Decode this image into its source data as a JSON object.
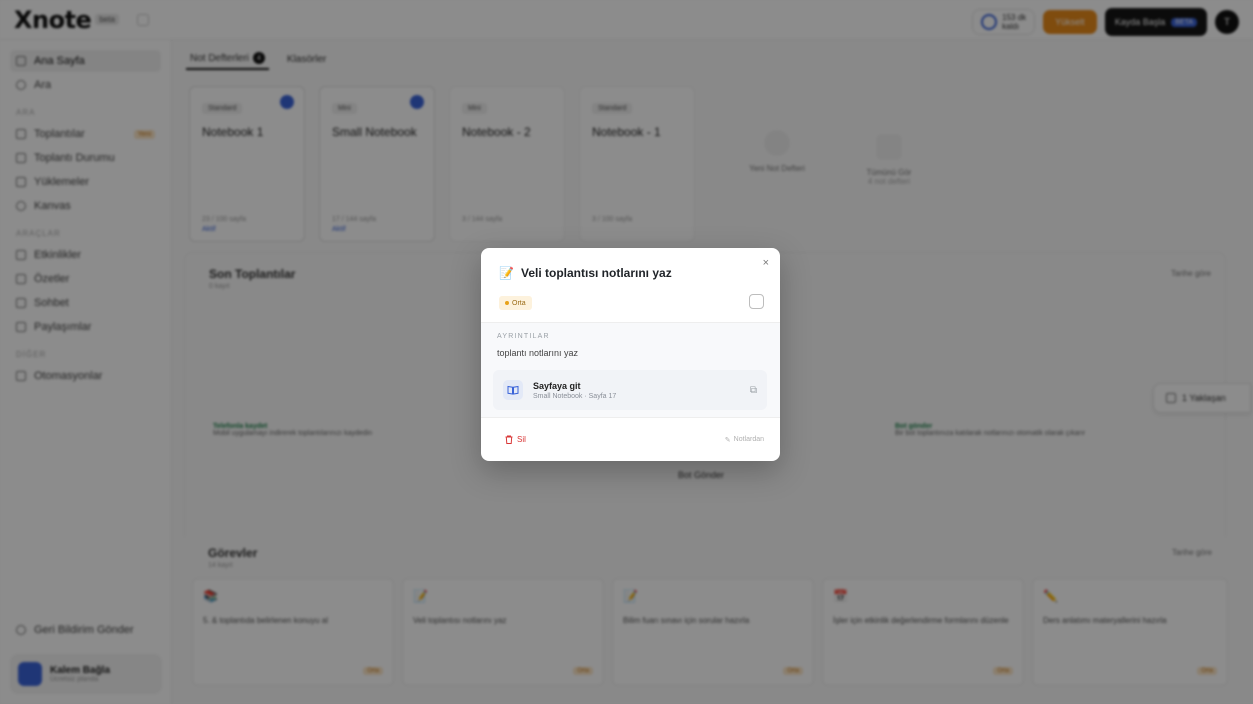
{
  "topbar": {
    "logo": "Xnote",
    "logo_badge": "beta",
    "credit_line1": "153 dk",
    "credit_line2": "kaldı",
    "upgrade_label": "Yükselt",
    "start_label": "Kayda Başla",
    "start_badge": "BETA",
    "avatar_initial": "T"
  },
  "sidebar": {
    "items": [
      {
        "label": "Ana Sayfa",
        "icon": "home-icon"
      },
      {
        "label": "Ara",
        "icon": "search-icon"
      }
    ],
    "section1": "ARA",
    "items2": [
      {
        "label": "Toplantılar",
        "icon": "calendar-icon",
        "badge": "Yeni"
      },
      {
        "label": "Toplantı Durumu",
        "icon": "calendar-icon"
      },
      {
        "label": "Yüklemeler",
        "icon": "upload-icon"
      },
      {
        "label": "Kanvas",
        "icon": "clock-icon"
      }
    ],
    "section2": "ARAÇLAR",
    "items3": [
      {
        "label": "Etkinlikler",
        "icon": "grid-icon"
      },
      {
        "label": "Özetler",
        "icon": "doc-icon"
      },
      {
        "label": "Sohbet",
        "icon": "chat-icon"
      },
      {
        "label": "Paylaşımlar",
        "icon": "share-icon"
      }
    ],
    "section3": "DİĞER",
    "items4": [
      {
        "label": "Otomasyonlar",
        "icon": "bolt-icon"
      }
    ],
    "changelog": "Geri Bildirim Gönder",
    "user_name": "Kalem Bağla",
    "user_sub": "Ücretsiz planda"
  },
  "main": {
    "tabs": [
      {
        "label": "Not Defterleri",
        "count": "4"
      },
      {
        "label": "Klasörler"
      }
    ],
    "notebooks": [
      {
        "tag": "Standard",
        "title": "Notebook 1",
        "meta": "23 / 100 sayfa",
        "status": "Aktif"
      },
      {
        "tag": "Mini",
        "title": "Small Notebook",
        "meta": "17 / 144 sayfa",
        "status": "Aktif"
      },
      {
        "tag": "Mini",
        "title": "Notebook - 2",
        "meta": "3 / 144 sayfa",
        "status": ""
      },
      {
        "tag": "Standard",
        "title": "Notebook - 1",
        "meta": "3 / 100 sayfa",
        "status": ""
      }
    ],
    "new_notebook": "Yeni Not Defteri",
    "see_all": "Tümünü Gör",
    "see_all_sub": "4 not defteri",
    "meetings_title": "Son Toplantılar",
    "meetings_sub": "0 kayıt",
    "meetings_sort": "Tarihe göre",
    "hint_left_title": "Telefonla kaydet",
    "hint_left_body": "Mobil uygulamayı indirerek toplantılarınızı kaydedin",
    "hint_right_title": "Bot gönder",
    "hint_right_body": "Bir bot toplantınıza katılarak notlarınızı otomatik olarak çıkarır",
    "bot_link": "Bot Gönder",
    "tasks_title": "Görevler",
    "tasks_sub": "14 kayıt",
    "tasks_sort": "Tarihe göre",
    "tasks": [
      {
        "emoji": "📚",
        "text": "5. & toplantıda belirlenen konuyu al"
      },
      {
        "emoji": "📝",
        "text": "Veli toplantısı notlarını yaz"
      },
      {
        "emoji": "📝",
        "text": "Bilim fuarı sınavı için sorular hazırla"
      },
      {
        "emoji": "📅",
        "text": "İşler için etkinlik değerlendirme formlarını düzenle"
      },
      {
        "emoji": "✏️",
        "text": "Ders anlatımı materyallerini hazırla"
      }
    ],
    "task_badge": "Orta",
    "float_pill": "1 Yaklaşan"
  },
  "modal": {
    "emoji": "📝",
    "title": "Veli toplantısı notlarını yaz",
    "priority": "Orta",
    "details_label": "AYRINTILAR",
    "description": "toplantı notlarını yaz",
    "page_title": "Sayfaya git",
    "page_sub": "Small Notebook · Sayfa 17",
    "delete_label": "Sil",
    "notes_label": "Notlardan",
    "close_glyph": "×",
    "accent": "#3a63d8",
    "delete_color": "#d93636",
    "priority_color": "#e8a21a"
  }
}
